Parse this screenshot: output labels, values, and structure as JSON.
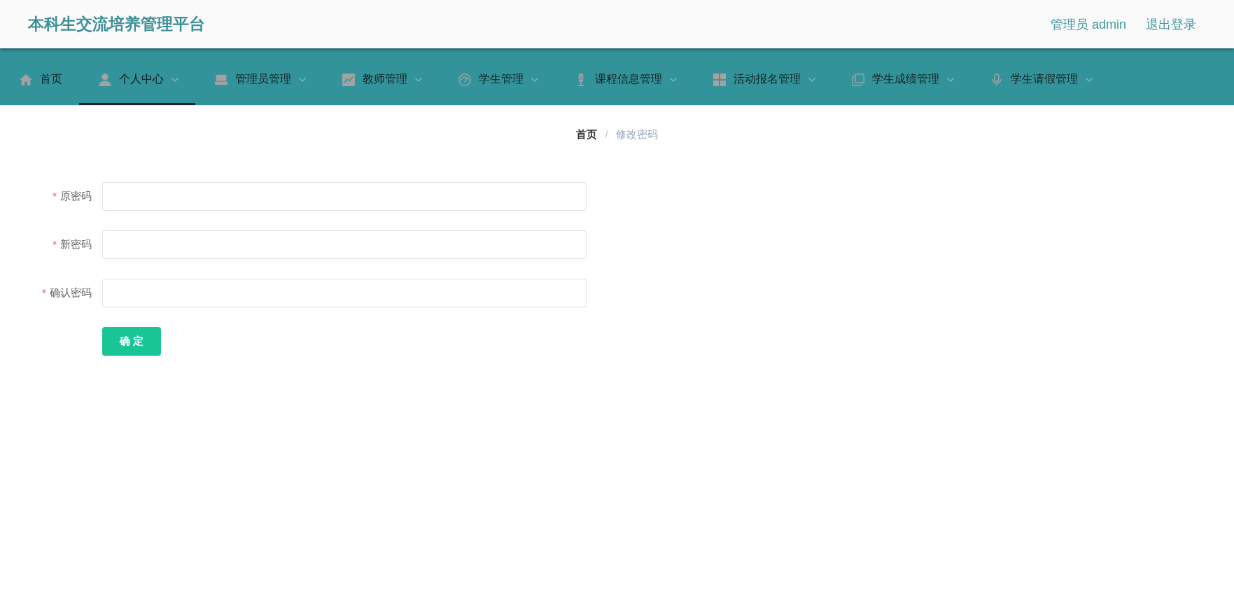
{
  "header": {
    "title": "本科生交流培养管理平台",
    "user": "管理员 admin",
    "logout": "退出登录"
  },
  "nav": [
    {
      "label": "首页",
      "kind": "link",
      "selected": false
    },
    {
      "label": "个人中心",
      "kind": "submenu",
      "selected": true
    },
    {
      "label": "管理员管理",
      "kind": "submenu",
      "selected": false
    },
    {
      "label": "教师管理",
      "kind": "submenu",
      "selected": false
    },
    {
      "label": "学生管理",
      "kind": "submenu",
      "selected": false
    },
    {
      "label": "课程信息管理",
      "kind": "submenu",
      "selected": false
    },
    {
      "label": "活动报名管理",
      "kind": "submenu",
      "selected": false
    },
    {
      "label": "学生成绩管理",
      "kind": "submenu",
      "selected": false
    },
    {
      "label": "学生请假管理",
      "kind": "submenu",
      "selected": false
    }
  ],
  "breadcrumb": {
    "separator": "/",
    "items": [
      {
        "label": "首页",
        "current": false
      },
      {
        "label": "修改密码",
        "current": true
      }
    ]
  },
  "form": {
    "fields": [
      {
        "label": "原密码",
        "required": true
      },
      {
        "label": "新密码",
        "required": true
      },
      {
        "label": "确认密码",
        "required": true
      }
    ],
    "submit": "确 定"
  }
}
